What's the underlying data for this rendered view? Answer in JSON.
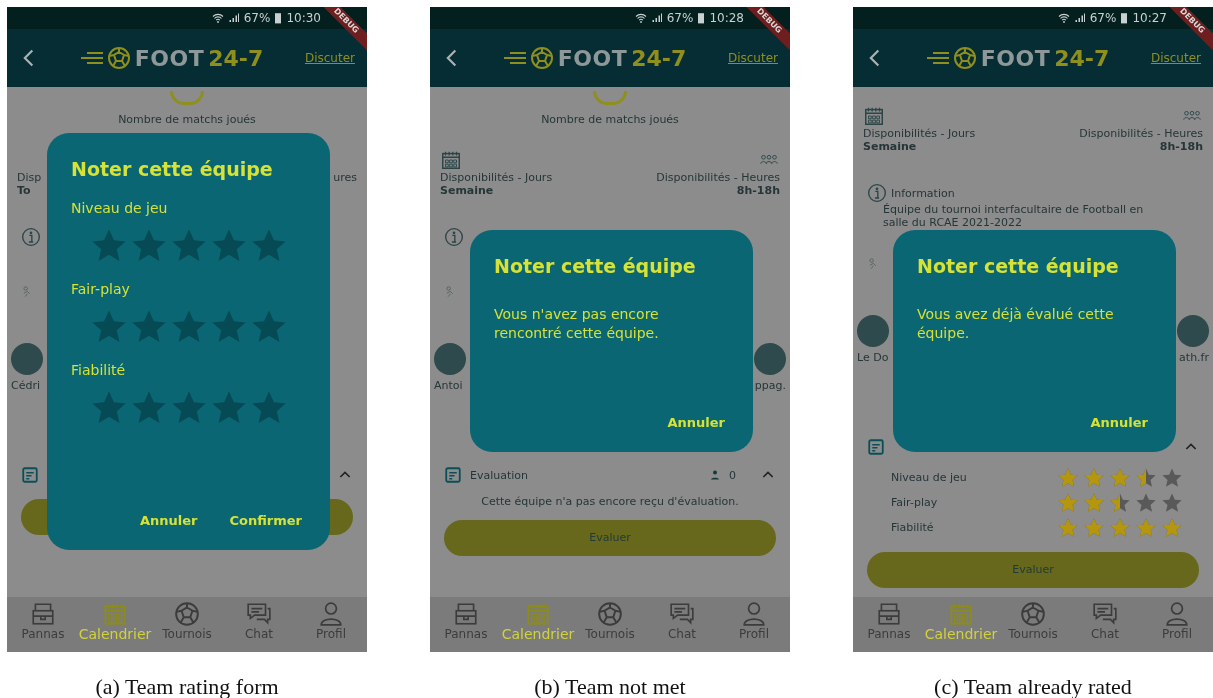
{
  "screens": [
    {
      "status_bar": {
        "battery": "67%",
        "time": "10:30"
      },
      "debug_banner": "DEBUG",
      "header": {
        "logo_main": "FOOT",
        "logo_accent": "24-7",
        "action": "Discuter"
      },
      "background": [
        {
          "kind": "stat",
          "label": "Nombre de matchs joués"
        },
        {
          "kind": "availability",
          "left": {
            "icon_visible": false,
            "label": "Disp",
            "value": "To"
          },
          "right": {
            "icon_visible": false,
            "label": "ures"
          }
        },
        {
          "kind": "info"
        },
        {
          "kind": "icon_row"
        },
        {
          "kind": "players",
          "left": "Cédri"
        },
        {
          "kind": "evaluation_header"
        },
        {
          "kind": "button"
        }
      ],
      "dialog": {
        "kind": "form",
        "title": "Noter cette équipe",
        "ratings": [
          {
            "label": "Niveau de jeu"
          },
          {
            "label": "Fair-play"
          },
          {
            "label": "Fiabilité"
          }
        ],
        "actions": [
          "Annuler",
          "Confirmer"
        ]
      },
      "nav": [
        {
          "label": "Pannas",
          "selected": false
        },
        {
          "label": "Calendrier",
          "selected": true
        },
        {
          "label": "Tournois",
          "selected": false
        },
        {
          "label": "Chat",
          "selected": false
        },
        {
          "label": "Profil",
          "selected": false
        }
      ],
      "caption": "(a) Team rating form"
    },
    {
      "status_bar": {
        "battery": "67%",
        "time": "10:28"
      },
      "debug_banner": "DEBUG",
      "header": {
        "logo_main": "FOOT",
        "logo_accent": "24-7",
        "action": "Discuter"
      },
      "background": [
        {
          "kind": "stat",
          "label": "Nombre de matchs joués"
        },
        {
          "kind": "availability",
          "left": {
            "icon_visible": true,
            "label": "Disponibilités - Jours",
            "value": "Semaine"
          },
          "right": {
            "icon_visible": true,
            "label": "Disponibilités - Heures",
            "value": "8h-18h"
          }
        },
        {
          "kind": "info"
        },
        {
          "kind": "icon_row"
        },
        {
          "kind": "players",
          "left": "Antoi",
          "right": "ppag."
        },
        {
          "kind": "evaluation_header",
          "title": "Evaluation",
          "count": "0"
        },
        {
          "kind": "note",
          "text": "Cette équipe n'a pas encore reçu d'évaluation."
        },
        {
          "kind": "button",
          "label": "Evaluer"
        }
      ],
      "dialog": {
        "kind": "message",
        "title": "Noter cette équipe",
        "message": "Vous n'avez pas encore rencontré cette équipe.",
        "actions": [
          "Annuler"
        ]
      },
      "nav": [
        {
          "label": "Pannas",
          "selected": false
        },
        {
          "label": "Calendrier",
          "selected": true
        },
        {
          "label": "Tournois",
          "selected": false
        },
        {
          "label": "Chat",
          "selected": false
        },
        {
          "label": "Profil",
          "selected": false
        }
      ],
      "caption": "(b) Team not met"
    },
    {
      "status_bar": {
        "battery": "67%",
        "time": "10:27"
      },
      "debug_banner": "DEBUG",
      "header": {
        "logo_main": "FOOT",
        "logo_accent": "24-7",
        "action": "Discuter"
      },
      "background": [
        {
          "kind": "availability",
          "left": {
            "icon_visible": true,
            "label": "Disponibilités - Jours",
            "value": "Semaine"
          },
          "right": {
            "icon_visible": true,
            "label": "Disponibilités - Heures",
            "value": "8h-18h"
          }
        },
        {
          "kind": "info",
          "title": "Information",
          "text": "Équipe du tournoi interfacultaire de Football en salle du RCAE 2021-2022"
        },
        {
          "kind": "icon_row"
        },
        {
          "kind": "players",
          "left": "Le Do",
          "right": "ath.fr"
        },
        {
          "kind": "evaluation_header"
        },
        {
          "kind": "ratings",
          "items": [
            {
              "label": "Niveau de jeu",
              "stars": 3.5
            },
            {
              "label": "Fair-play",
              "stars": 2.5
            },
            {
              "label": "Fiabilité",
              "stars": 5
            }
          ]
        },
        {
          "kind": "button",
          "label": "Evaluer"
        }
      ],
      "dialog": {
        "kind": "message",
        "title": "Noter cette équipe",
        "message": "Vous avez déjà évalué cette équipe.",
        "actions": [
          "Annuler"
        ]
      },
      "nav": [
        {
          "label": "Pannas",
          "selected": false
        },
        {
          "label": "Calendrier",
          "selected": true
        },
        {
          "label": "Tournois",
          "selected": false
        },
        {
          "label": "Chat",
          "selected": false
        },
        {
          "label": "Profil",
          "selected": false
        }
      ],
      "caption": "(c) Team already rated"
    }
  ]
}
